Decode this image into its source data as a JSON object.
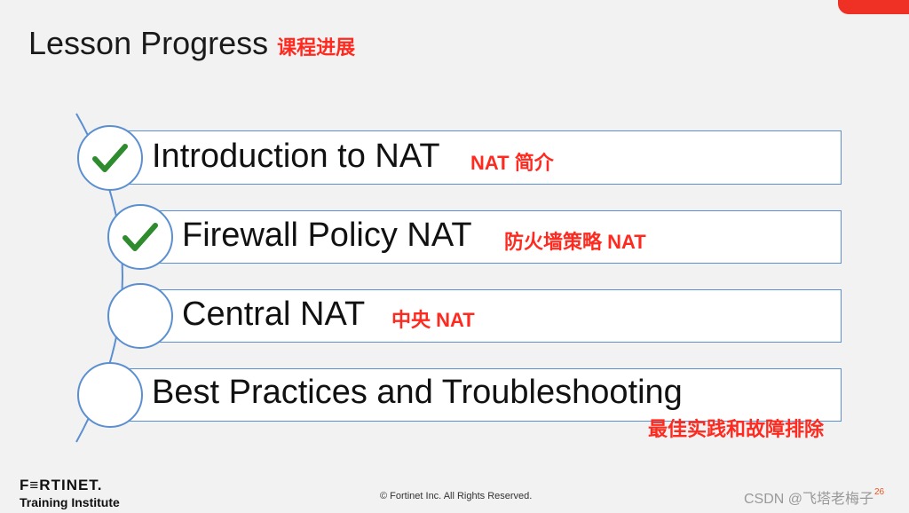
{
  "header": {
    "title": "Lesson Progress",
    "title_cn": "课程进展"
  },
  "items": [
    {
      "label": "Introduction to NAT",
      "label_cn": "NAT 简介",
      "completed": true
    },
    {
      "label": "Firewall Policy NAT",
      "label_cn": "防火墙策略 NAT",
      "completed": true
    },
    {
      "label": "Central NAT",
      "label_cn": "中央 NAT",
      "completed": false
    },
    {
      "label": "Best Practices and Troubleshooting",
      "label_cn": "最佳实践和故障排除",
      "completed": false
    }
  ],
  "footer": {
    "logo": "F≡RTINET.",
    "logo_sub": "Training Institute",
    "copyright": "© Fortinet Inc. All Rights Reserved.",
    "page": "26",
    "watermark": "CSDN @飞塔老梅子"
  },
  "colors": {
    "accent": "#ee3124",
    "cn_text": "#ff2a1f",
    "border": "#5b8fd0",
    "check": "#2e8b2e"
  }
}
